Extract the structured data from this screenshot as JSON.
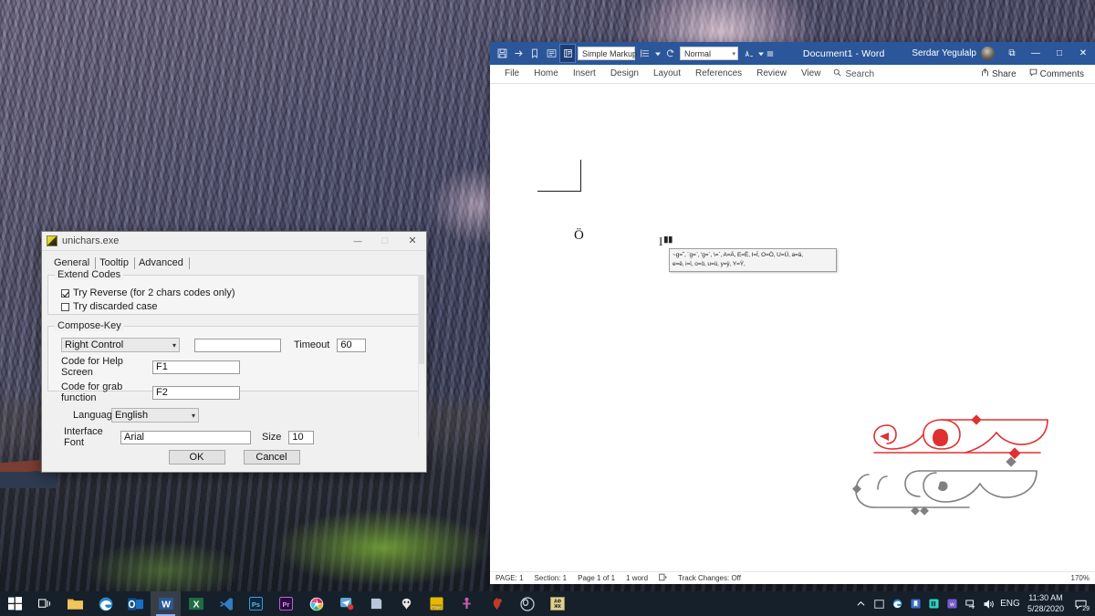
{
  "dialog": {
    "title": "unichars.exe",
    "icon": "app-icon",
    "window_controls": {
      "minimize": "—",
      "maximize": "□",
      "close": "✕"
    },
    "tabs": [
      {
        "label": "General",
        "active": true
      },
      {
        "label": "Tooltip",
        "active": false
      },
      {
        "label": "Advanced",
        "active": false
      }
    ],
    "extend_codes": {
      "legend": "Extend Codes",
      "checkboxes": [
        {
          "label": "Try Reverse (for 2 chars codes only)",
          "checked": true
        },
        {
          "label": "Try discarded case",
          "checked": false
        }
      ]
    },
    "compose_key": {
      "legend": "Compose-Key",
      "key_select": {
        "value": "Right Control",
        "arrow": "⌵"
      },
      "secondary_value": "",
      "timeout_label": "Timeout",
      "timeout_value": "60",
      "help_screen_label": "Code for Help Screen",
      "help_screen_value": "F1",
      "grab_function_label": "Code for grab function",
      "grab_function_value": "F2"
    },
    "language_label": "Language",
    "language_value": "English",
    "interface_font_label": "Interface Font",
    "interface_font_value": "Arial",
    "size_label": "Size",
    "size_value": "10",
    "buttons": {
      "ok": "OK",
      "cancel": "Cancel"
    }
  },
  "word": {
    "title": "Document1  -  Word",
    "account_name": "Serdar Yegulalp",
    "quick_access": [
      {
        "name": "save-icon",
        "glyph": "὚B",
        "active": false
      },
      {
        "name": "redo-icon",
        "glyph": "→",
        "active": false
      },
      {
        "name": "bookmark-icon",
        "glyph": "☐",
        "active": false
      },
      {
        "name": "read-mode-icon",
        "glyph": "≡",
        "active": false
      },
      {
        "name": "print-layout-icon",
        "glyph": "▤",
        "active": true
      }
    ],
    "markup_dropdown": {
      "value": "Simple Markup",
      "arrow": "▾"
    },
    "style_dropdown": {
      "value": "Normal",
      "arrow": "▾"
    },
    "window_controls": {
      "ribbon_display": "⧉",
      "minimize": "—",
      "maximize": "□",
      "close": "✕"
    },
    "ribbon_tabs": [
      "File",
      "Home",
      "Insert",
      "Design",
      "Layout",
      "References",
      "Review",
      "View"
    ],
    "search_placeholder": "Search",
    "share_label": "Share",
    "comments_label": "Comments",
    "document": {
      "character": "Ö",
      "cursor_glyph": "I",
      "tooltip_line1": "~g=˜, ¨g=¨, 'g=´, \\=ˋ, A=Ä, E=Ë, I=Ï, O=Ö, U=Ü, a=ä,",
      "tooltip_line2": "e=ë, i=ï, o=ö, u=ü, y=ÿ, Y=Ÿ,"
    },
    "logo": {
      "name": "persian-calligraphy-logo",
      "top_text": "برنامه",
      "bottom_text": "نویسان",
      "top_color": "#e03030",
      "bottom_color": "#808080"
    },
    "status_bar": {
      "page": "PAGE: 1",
      "section": "Section: 1",
      "page_of": "Page 1 of 1",
      "words": "1 word",
      "proof_icon": "⌧",
      "track_changes": "Track Changes: Off",
      "zoom": "170%"
    }
  },
  "taskbar": {
    "start": {
      "name": "start-button",
      "glyph": "⊞"
    },
    "task_view": {
      "name": "task-view-button",
      "glyph": "▧"
    },
    "apps": [
      {
        "name": "file-explorer",
        "label": "",
        "color": "#e8b33a",
        "glyph": ""
      },
      {
        "name": "microsoft-edge",
        "label": "",
        "color": "#2e86c8",
        "glyph": ""
      },
      {
        "name": "outlook",
        "label": "o",
        "color": "#0f6cbd",
        "glyph": "o"
      },
      {
        "name": "word",
        "label": "W",
        "color": "#2b579a",
        "glyph": "W",
        "active": true
      },
      {
        "name": "excel",
        "label": "X",
        "color": "#1d6f42",
        "glyph": "X"
      },
      {
        "name": "visual-studio-code",
        "label": "",
        "color": "#2e6ea6",
        "glyph": ""
      },
      {
        "name": "photoshop",
        "label": "Ps",
        "color": "#1b3a5c",
        "glyph": "Ps"
      },
      {
        "name": "premiere-pro",
        "label": "Pr",
        "color": "#2a0a40",
        "glyph": "Pr"
      },
      {
        "name": "slack",
        "label": "",
        "color": "#3aae5a",
        "glyph": ""
      },
      {
        "name": "telegram",
        "label": "",
        "color": "#c73a3a",
        "glyph": ""
      },
      {
        "name": "onenote",
        "label": "",
        "color": "#7a3fa0",
        "glyph": ""
      },
      {
        "name": "alienware",
        "label": "",
        "color": "#e6e6e6",
        "glyph": ""
      },
      {
        "name": "media-player",
        "label": "",
        "color": "#e8b800",
        "glyph": ""
      },
      {
        "name": "utility-app",
        "label": "",
        "color": "#b0468c",
        "glyph": ""
      },
      {
        "name": "red-app",
        "label": "",
        "color": "#c0392b",
        "glyph": ""
      },
      {
        "name": "obs-studio",
        "label": "",
        "color": "#4a4a4a",
        "glyph": ""
      },
      {
        "name": "dictionary-app",
        "label": "АБ",
        "color": "#d4c45a",
        "glyph": "АБ"
      }
    ],
    "tray": {
      "chevron": "∧",
      "icons": [
        {
          "name": "display-icon",
          "color": "#c9d2d9",
          "glyph": "□"
        },
        {
          "name": "browser-tray-icon",
          "color": "#2e86c8",
          "glyph": "●"
        },
        {
          "name": "app-tray-icon-blue",
          "color": "#3b6fc4",
          "glyph": "⚑"
        },
        {
          "name": "app-tray-icon-teal",
          "color": "#2fd6c8",
          "glyph": "▌"
        },
        {
          "name": "app-tray-icon-purple",
          "color": "#7a5ad0",
          "glyph": "w"
        },
        {
          "name": "network-icon",
          "glyph": "὚7"
        },
        {
          "name": "volume-icon",
          "glyph": "ὐA"
        }
      ],
      "language": "ENG",
      "time": "11:30 AM",
      "date": "5/28/2020",
      "notification_count": "29"
    }
  }
}
